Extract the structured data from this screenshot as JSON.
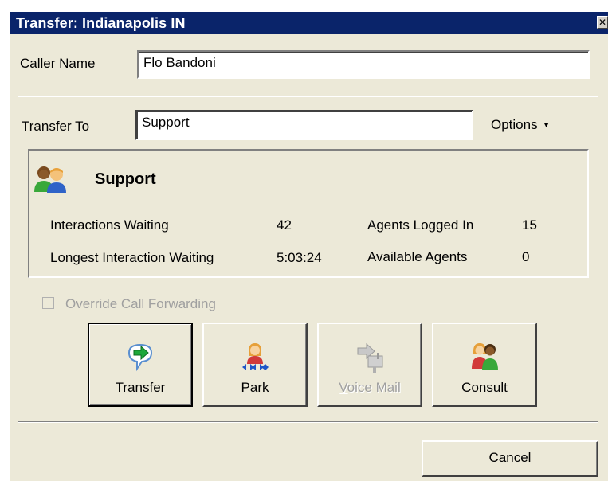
{
  "window": {
    "title": "Transfer: Indianapolis IN",
    "close_glyph": "✕"
  },
  "caller": {
    "label": "Caller Name",
    "value": "Flo Bandoni"
  },
  "transfer": {
    "label": "Transfer To",
    "value": "Support",
    "options_label": "Options"
  },
  "queue": {
    "name": "Support",
    "icon": "agents-group-icon",
    "stats": {
      "interactions_waiting_label": "Interactions Waiting",
      "interactions_waiting_value": "42",
      "longest_label": "Longest Interaction Waiting",
      "longest_value": "5:03:24",
      "agents_logged_label": "Agents Logged In",
      "agents_logged_value": "15",
      "available_label": "Available Agents",
      "available_value": "0"
    }
  },
  "override": {
    "label": "Override Call Forwarding",
    "checked": false,
    "enabled": false
  },
  "actions": [
    {
      "key": "T",
      "rest": "ransfer",
      "icon": "transfer-icon",
      "enabled": true
    },
    {
      "key": "P",
      "rest": "ark",
      "icon": "park-icon",
      "enabled": true
    },
    {
      "key": "V",
      "rest": "oice Mail",
      "icon": "voice-mail-icon",
      "enabled": false
    },
    {
      "key": "C",
      "rest": "onsult",
      "icon": "consult-icon",
      "enabled": true
    }
  ],
  "cancel": {
    "key": "C",
    "rest": "ancel"
  }
}
